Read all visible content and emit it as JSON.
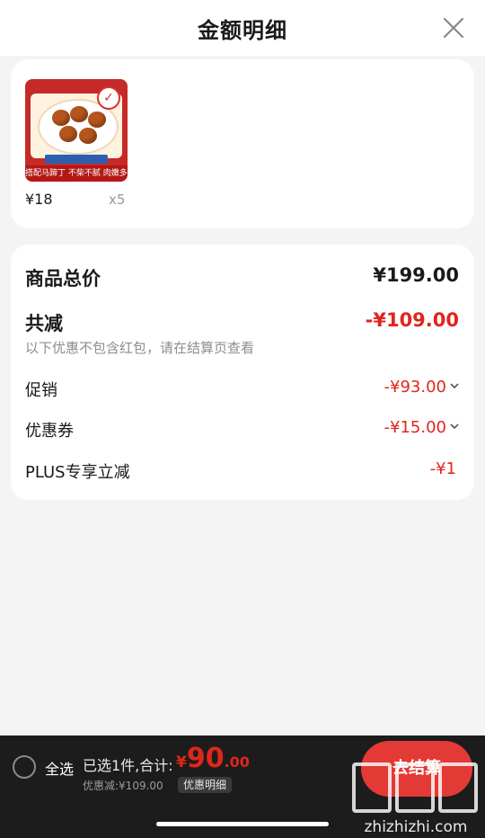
{
  "header": {
    "title": "金额明细"
  },
  "product": {
    "price": "¥18",
    "quantity": "x5",
    "image_caption": "搭配马蹄丁 不柴不腻 肉嫩多汁"
  },
  "summary": {
    "total_label": "商品总价",
    "total_value": "¥199.00",
    "reduce_label": "共减",
    "reduce_value": "-¥109.00",
    "hint": "以下优惠不包含红包，请在结算页查看",
    "items": [
      {
        "label": "促销",
        "value": "-¥93.00"
      },
      {
        "label": "优惠券",
        "value": "-¥15.00"
      },
      {
        "label": "PLUS专享立减",
        "value": "-¥1"
      }
    ]
  },
  "bottom": {
    "select_all": "全选",
    "selected_text": "已选1件,合计:",
    "total_yen": "¥",
    "total_int": "90",
    "total_dec": ".00",
    "discount_text": "优惠减:¥109.00",
    "detail_label": "优惠明细",
    "checkout_label": "去结算",
    "watermark_text": "zhizhizhi.com"
  },
  "colors": {
    "accent": "#e1251b",
    "checkout": "#e33a36",
    "bar": "#1c1c1c"
  },
  "icons": {
    "close": "close-icon",
    "chevron": "chevron-down-icon"
  }
}
